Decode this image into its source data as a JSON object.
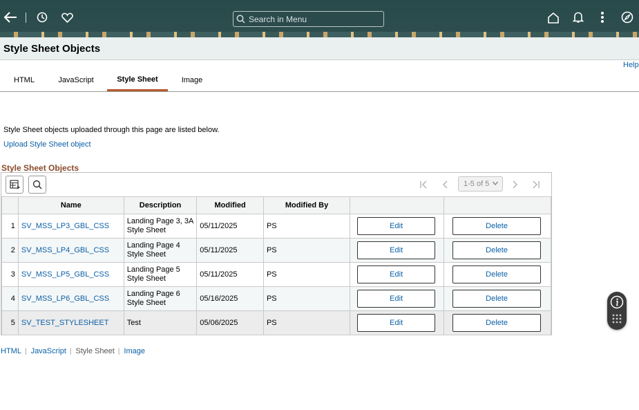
{
  "header": {
    "search_placeholder": "Search in Menu"
  },
  "page": {
    "title": "Style Sheet Objects",
    "help_label": "Help"
  },
  "tabs": [
    {
      "label": "HTML",
      "active": false
    },
    {
      "label": "JavaScript",
      "active": false
    },
    {
      "label": "Style Sheet",
      "active": true
    },
    {
      "label": "Image",
      "active": false
    }
  ],
  "intro_text": "Style Sheet objects uploaded through this page are listed below.",
  "upload_link": "Upload Style Sheet object",
  "grid": {
    "title": "Style Sheet Objects",
    "pager_label": "1-5 of 5",
    "columns": [
      "Name",
      "Description",
      "Modified",
      "Modified By"
    ],
    "rows": [
      {
        "num": "1",
        "name": "SV_MSS_LP3_GBL_CSS",
        "description": "Landing Page 3, 3A Style Sheet",
        "modified": "05/11/2025",
        "modified_by": "PS",
        "edit": "Edit",
        "delete": "Delete"
      },
      {
        "num": "2",
        "name": "SV_MSS_LP4_GBL_CSS",
        "description": "Landing Page 4 Style Sheet",
        "modified": "05/11/2025",
        "modified_by": "PS",
        "edit": "Edit",
        "delete": "Delete"
      },
      {
        "num": "3",
        "name": "SV_MSS_LP5_GBL_CSS",
        "description": "Landing Page 5 Style Sheet",
        "modified": "05/11/2025",
        "modified_by": "PS",
        "edit": "Edit",
        "delete": "Delete"
      },
      {
        "num": "4",
        "name": "SV_MSS_LP6_GBL_CSS",
        "description": "Landing Page 6 Style Sheet",
        "modified": "05/16/2025",
        "modified_by": "PS",
        "edit": "Edit",
        "delete": "Delete"
      },
      {
        "num": "5",
        "name": "SV_TEST_STYLESHEET",
        "description": "Test",
        "modified": "05/06/2025",
        "modified_by": "PS",
        "edit": "Edit",
        "delete": "Delete"
      }
    ]
  },
  "footer_links": [
    {
      "label": "HTML",
      "current": false
    },
    {
      "label": "JavaScript",
      "current": false
    },
    {
      "label": "Style Sheet",
      "current": true
    },
    {
      "label": "Image",
      "current": false
    }
  ],
  "colors": {
    "header_bg": "#2f4f4f",
    "link": "#0a5fa6",
    "active_tab_underline": "#b55a2e",
    "grid_title": "#8b4a2b"
  },
  "icons": [
    "back-icon",
    "history-icon",
    "favorites-icon",
    "search-icon",
    "home-icon",
    "notifications-icon",
    "more-actions-icon",
    "navigator-icon",
    "personalize-grid-icon",
    "find-icon",
    "first-page-icon",
    "previous-page-icon",
    "next-page-icon",
    "last-page-icon",
    "info-icon",
    "keypad-icon"
  ]
}
